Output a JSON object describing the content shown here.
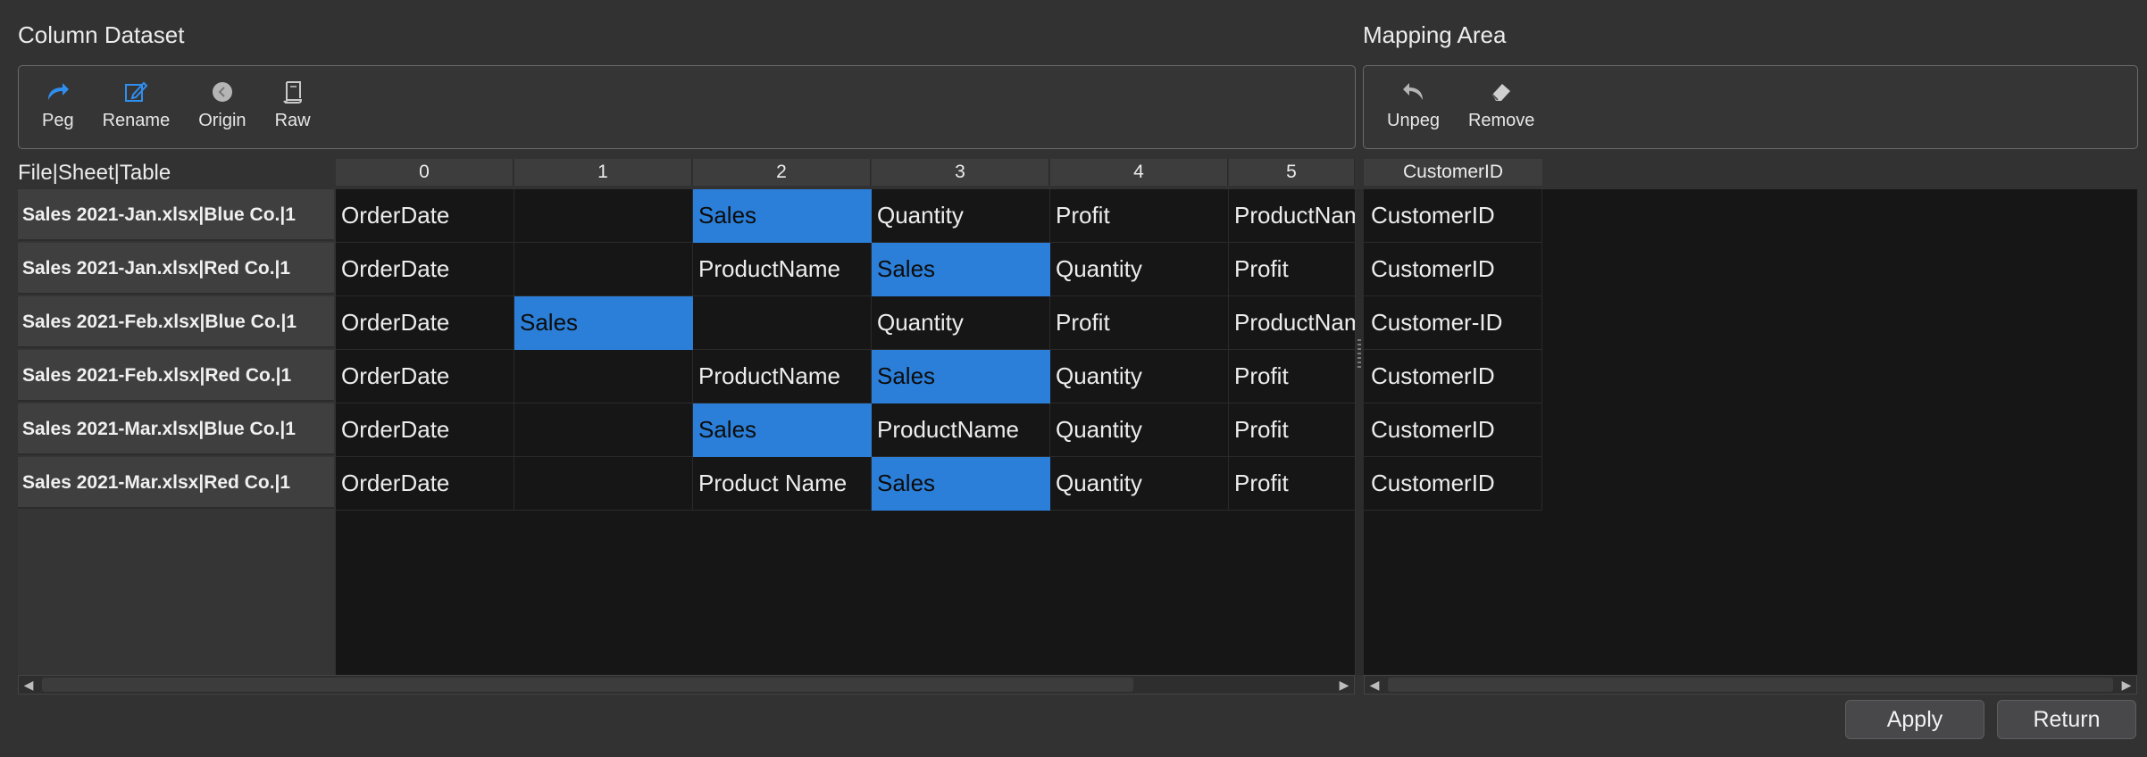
{
  "column_dataset": {
    "title": "Column Dataset",
    "toolbar": [
      {
        "id": "peg",
        "label": "Peg",
        "icon": "redo-arrow-icon"
      },
      {
        "id": "rename",
        "label": "Rename",
        "icon": "edit-icon"
      },
      {
        "id": "origin",
        "label": "Origin",
        "icon": "origin-icon"
      },
      {
        "id": "raw",
        "label": "Raw",
        "icon": "scroll-icon"
      }
    ],
    "corner_label": "File|Sheet|Table",
    "columns": [
      "0",
      "1",
      "2",
      "3",
      "4",
      "5"
    ],
    "rows": [
      {
        "label": "Sales 2021-Jan.xlsx|Blue Co.|1",
        "cells": [
          "OrderDate",
          "",
          "Sales",
          "Quantity",
          "Profit",
          "ProductName"
        ],
        "selected": 2
      },
      {
        "label": "Sales 2021-Jan.xlsx|Red Co.|1",
        "cells": [
          "OrderDate",
          "",
          "ProductName",
          "Sales",
          "Quantity",
          "Profit"
        ],
        "selected": 3
      },
      {
        "label": "Sales 2021-Feb.xlsx|Blue Co.|1",
        "cells": [
          "OrderDate",
          "Sales",
          "",
          "Quantity",
          "Profit",
          "ProductName"
        ],
        "selected": 1
      },
      {
        "label": "Sales 2021-Feb.xlsx|Red Co.|1",
        "cells": [
          "OrderDate",
          "",
          "ProductName",
          "Sales",
          "Quantity",
          "Profit"
        ],
        "selected": 3
      },
      {
        "label": "Sales 2021-Mar.xlsx|Blue Co.|1",
        "cells": [
          "OrderDate",
          "",
          "Sales",
          "ProductName",
          "Quantity",
          "Profit"
        ],
        "selected": 2
      },
      {
        "label": "Sales 2021-Mar.xlsx|Red Co.|1",
        "cells": [
          "OrderDate",
          "",
          "Product Name",
          "Sales",
          "Quantity",
          "Profit"
        ],
        "selected": 3
      }
    ]
  },
  "mapping_area": {
    "title": "Mapping Area",
    "toolbar": [
      {
        "id": "unpeg",
        "label": "Unpeg",
        "icon": "undo-arrow-icon"
      },
      {
        "id": "remove",
        "label": "Remove",
        "icon": "eraser-icon"
      }
    ],
    "column": "CustomerID",
    "values": [
      "CustomerID",
      "CustomerID",
      "Customer-ID",
      "CustomerID",
      "CustomerID",
      "CustomerID"
    ]
  },
  "buttons": {
    "apply": "Apply",
    "return": "Return"
  },
  "colors": {
    "selection": "#2b7fd8",
    "accent_icon": "#2f8ff0"
  }
}
